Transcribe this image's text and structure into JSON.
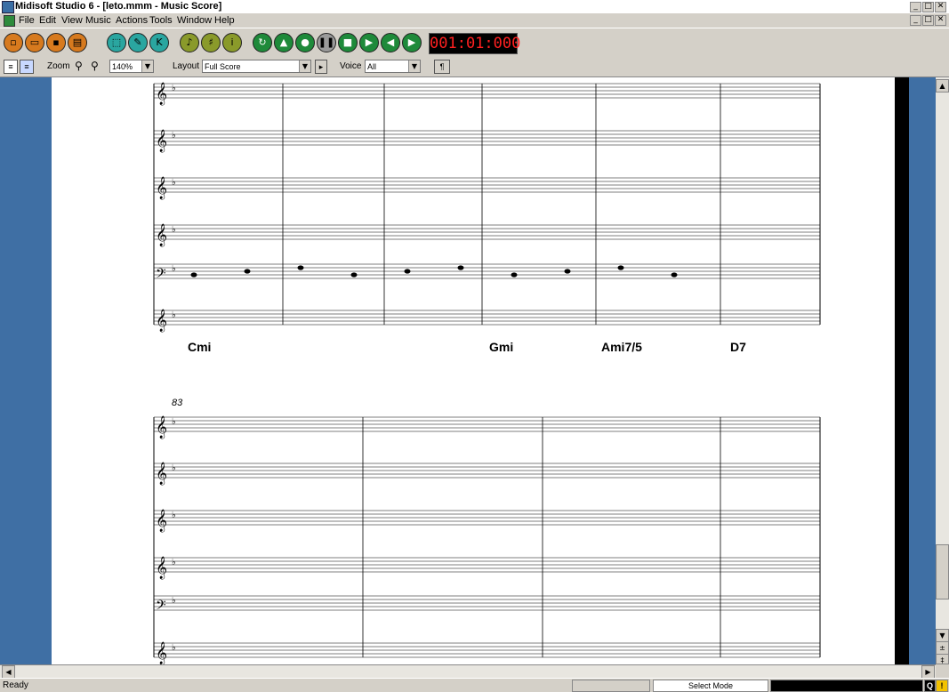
{
  "window": {
    "title": "Midisoft Studio 6 - [leto.mmm - Music Score]"
  },
  "menu": [
    "File",
    "Edit",
    "View",
    "Music",
    "Actions",
    "Tools",
    "Window",
    "Help"
  ],
  "toolbar": {
    "time_display": "001:01:000",
    "zoom_label": "Zoom",
    "zoom_value": "140%",
    "layout_label": "Layout",
    "layout_value": "Full Score",
    "voice_label": "Voice",
    "voice_value": "All"
  },
  "score": {
    "system1_chords": [
      "Cmi",
      "Gmi",
      "Ami7/5",
      "D7"
    ],
    "system2_measure_number": "83"
  },
  "status": {
    "ready": "Ready",
    "mode": "Select Mode",
    "indicator_q": "Q",
    "warning": "!"
  }
}
